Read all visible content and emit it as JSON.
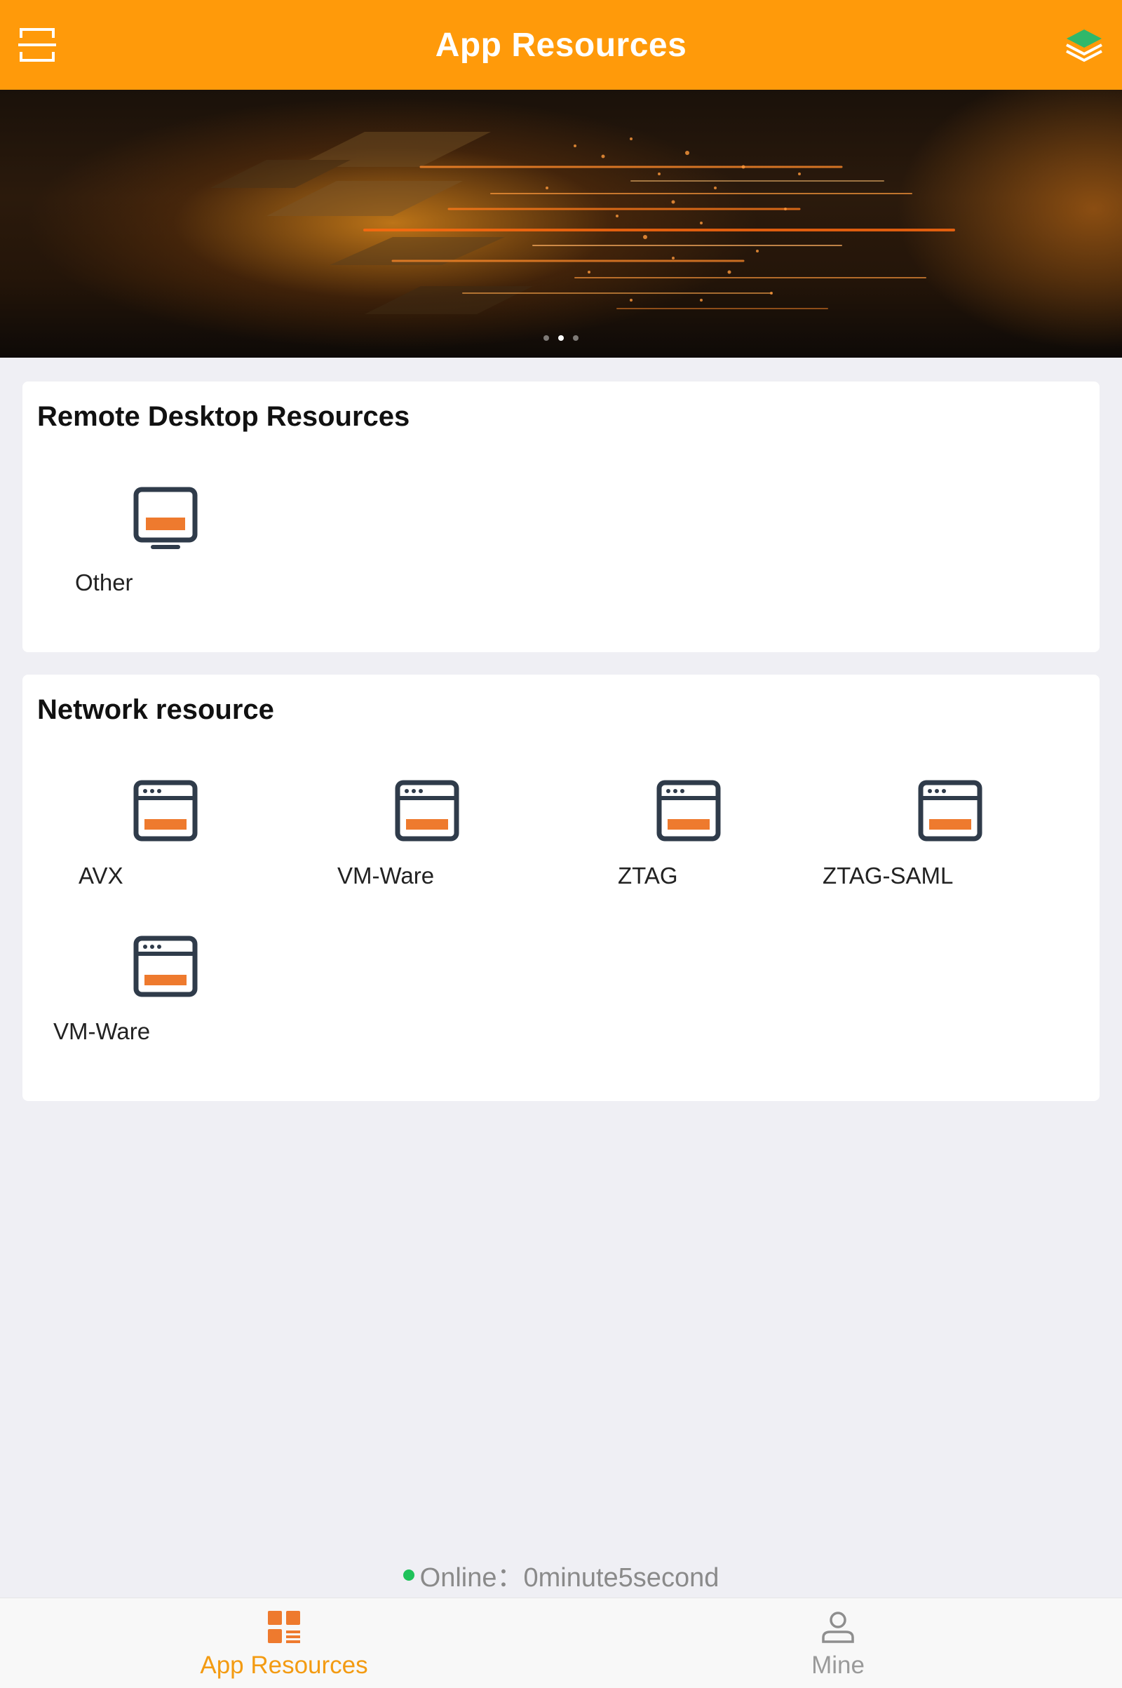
{
  "header": {
    "title": "App Resources",
    "left_icon": "scan-icon",
    "right_icon": "layers-icon",
    "bg_color": "#ff9a0a"
  },
  "banner": {
    "slide_count": 3,
    "active_slide": 2
  },
  "remote_desktop": {
    "title": "Remote Desktop Resources",
    "items": [
      {
        "label": "Other",
        "icon": "monitor-icon"
      }
    ]
  },
  "network": {
    "title": "Network resource",
    "items": [
      {
        "label": "AVX",
        "icon": "browser-window-icon"
      },
      {
        "label": "VM-Ware",
        "icon": "browser-window-icon"
      },
      {
        "label": "ZTAG",
        "icon": "browser-window-icon"
      },
      {
        "label": "ZTAG-SAML",
        "icon": "browser-window-icon"
      },
      {
        "label": "VM-Ware",
        "icon": "browser-window-icon"
      }
    ]
  },
  "status": {
    "text": "Online：0minute5second",
    "color": "#1fc25a"
  },
  "tabbar": {
    "tabs": [
      {
        "label": "App Resources",
        "icon": "grid-list-icon",
        "active": true
      },
      {
        "label": "Mine",
        "icon": "user-icon",
        "active": false
      }
    ],
    "accent": "#f39b12"
  }
}
